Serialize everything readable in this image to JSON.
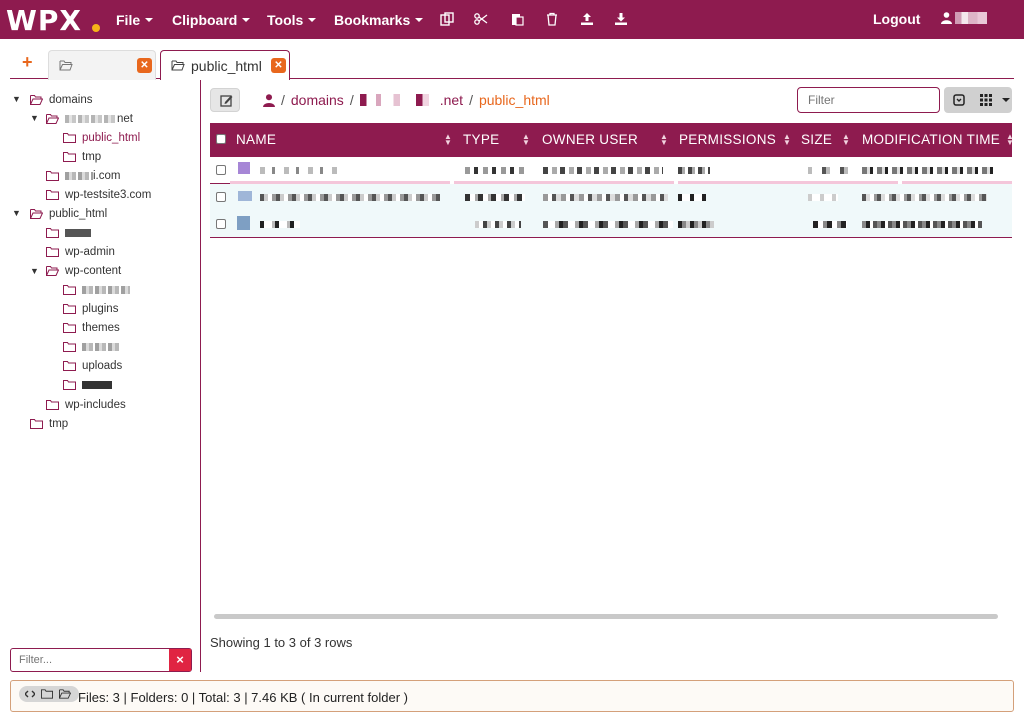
{
  "app": {
    "logo": "WPX"
  },
  "menu": {
    "file": "File",
    "clipboard": "Clipboard",
    "tools": "Tools",
    "bookmarks": "Bookmarks",
    "logout": "Logout"
  },
  "tabs": {
    "add": "+",
    "active_label": "public_html"
  },
  "tree": {
    "domains": "domains",
    "net_suffix": "net",
    "public_html_child": "public_html",
    "tmp_child": "tmp",
    "com_suffix": "i.com",
    "wp_testsite": "wp-testsite3.com",
    "public_html": "public_html",
    "wp_admin": "wp-admin",
    "wp_content": "wp-content",
    "plugins": "plugins",
    "themes": "themes",
    "uploads": "uploads",
    "wp_includes": "wp-includes",
    "tmp": "tmp"
  },
  "filter": {
    "placeholder": "Filter...",
    "clear": "×"
  },
  "breadcrumb": {
    "sep": "/",
    "domains": "domains",
    "net_suffix": ".net",
    "current": "public_html"
  },
  "search": {
    "placeholder": "Filter"
  },
  "grid": {
    "columns": [
      "NAME",
      "TYPE",
      "OWNER USER",
      "PERMISSIONS",
      "SIZE",
      "MODIFICATION TIME"
    ]
  },
  "footer": {
    "showing": "Showing 1 to 3 of 3 rows",
    "status": "Files: 3 | Folders: 0 | Total: 3 | 7.46 KB ( In current folder )"
  },
  "colors": {
    "brand": "#8e1b4f",
    "accent": "#e8671d",
    "danger": "#e02442"
  }
}
